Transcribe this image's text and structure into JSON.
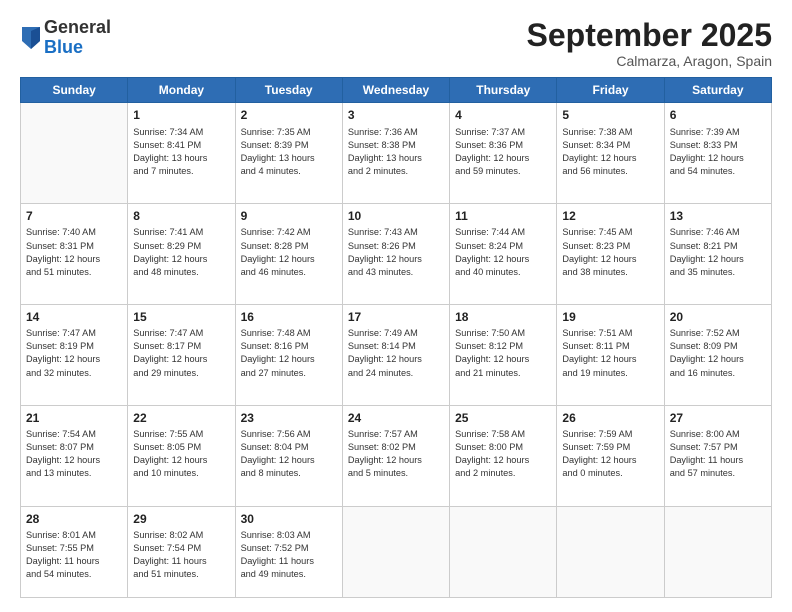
{
  "logo": {
    "line1": "General",
    "line2": "Blue"
  },
  "header": {
    "month": "September 2025",
    "location": "Calmarza, Aragon, Spain"
  },
  "weekdays": [
    "Sunday",
    "Monday",
    "Tuesday",
    "Wednesday",
    "Thursday",
    "Friday",
    "Saturday"
  ],
  "weeks": [
    [
      {
        "day": "",
        "lines": []
      },
      {
        "day": "1",
        "lines": [
          "Sunrise: 7:34 AM",
          "Sunset: 8:41 PM",
          "Daylight: 13 hours",
          "and 7 minutes."
        ]
      },
      {
        "day": "2",
        "lines": [
          "Sunrise: 7:35 AM",
          "Sunset: 8:39 PM",
          "Daylight: 13 hours",
          "and 4 minutes."
        ]
      },
      {
        "day": "3",
        "lines": [
          "Sunrise: 7:36 AM",
          "Sunset: 8:38 PM",
          "Daylight: 13 hours",
          "and 2 minutes."
        ]
      },
      {
        "day": "4",
        "lines": [
          "Sunrise: 7:37 AM",
          "Sunset: 8:36 PM",
          "Daylight: 12 hours",
          "and 59 minutes."
        ]
      },
      {
        "day": "5",
        "lines": [
          "Sunrise: 7:38 AM",
          "Sunset: 8:34 PM",
          "Daylight: 12 hours",
          "and 56 minutes."
        ]
      },
      {
        "day": "6",
        "lines": [
          "Sunrise: 7:39 AM",
          "Sunset: 8:33 PM",
          "Daylight: 12 hours",
          "and 54 minutes."
        ]
      }
    ],
    [
      {
        "day": "7",
        "lines": [
          "Sunrise: 7:40 AM",
          "Sunset: 8:31 PM",
          "Daylight: 12 hours",
          "and 51 minutes."
        ]
      },
      {
        "day": "8",
        "lines": [
          "Sunrise: 7:41 AM",
          "Sunset: 8:29 PM",
          "Daylight: 12 hours",
          "and 48 minutes."
        ]
      },
      {
        "day": "9",
        "lines": [
          "Sunrise: 7:42 AM",
          "Sunset: 8:28 PM",
          "Daylight: 12 hours",
          "and 46 minutes."
        ]
      },
      {
        "day": "10",
        "lines": [
          "Sunrise: 7:43 AM",
          "Sunset: 8:26 PM",
          "Daylight: 12 hours",
          "and 43 minutes."
        ]
      },
      {
        "day": "11",
        "lines": [
          "Sunrise: 7:44 AM",
          "Sunset: 8:24 PM",
          "Daylight: 12 hours",
          "and 40 minutes."
        ]
      },
      {
        "day": "12",
        "lines": [
          "Sunrise: 7:45 AM",
          "Sunset: 8:23 PM",
          "Daylight: 12 hours",
          "and 38 minutes."
        ]
      },
      {
        "day": "13",
        "lines": [
          "Sunrise: 7:46 AM",
          "Sunset: 8:21 PM",
          "Daylight: 12 hours",
          "and 35 minutes."
        ]
      }
    ],
    [
      {
        "day": "14",
        "lines": [
          "Sunrise: 7:47 AM",
          "Sunset: 8:19 PM",
          "Daylight: 12 hours",
          "and 32 minutes."
        ]
      },
      {
        "day": "15",
        "lines": [
          "Sunrise: 7:47 AM",
          "Sunset: 8:17 PM",
          "Daylight: 12 hours",
          "and 29 minutes."
        ]
      },
      {
        "day": "16",
        "lines": [
          "Sunrise: 7:48 AM",
          "Sunset: 8:16 PM",
          "Daylight: 12 hours",
          "and 27 minutes."
        ]
      },
      {
        "day": "17",
        "lines": [
          "Sunrise: 7:49 AM",
          "Sunset: 8:14 PM",
          "Daylight: 12 hours",
          "and 24 minutes."
        ]
      },
      {
        "day": "18",
        "lines": [
          "Sunrise: 7:50 AM",
          "Sunset: 8:12 PM",
          "Daylight: 12 hours",
          "and 21 minutes."
        ]
      },
      {
        "day": "19",
        "lines": [
          "Sunrise: 7:51 AM",
          "Sunset: 8:11 PM",
          "Daylight: 12 hours",
          "and 19 minutes."
        ]
      },
      {
        "day": "20",
        "lines": [
          "Sunrise: 7:52 AM",
          "Sunset: 8:09 PM",
          "Daylight: 12 hours",
          "and 16 minutes."
        ]
      }
    ],
    [
      {
        "day": "21",
        "lines": [
          "Sunrise: 7:54 AM",
          "Sunset: 8:07 PM",
          "Daylight: 12 hours",
          "and 13 minutes."
        ]
      },
      {
        "day": "22",
        "lines": [
          "Sunrise: 7:55 AM",
          "Sunset: 8:05 PM",
          "Daylight: 12 hours",
          "and 10 minutes."
        ]
      },
      {
        "day": "23",
        "lines": [
          "Sunrise: 7:56 AM",
          "Sunset: 8:04 PM",
          "Daylight: 12 hours",
          "and 8 minutes."
        ]
      },
      {
        "day": "24",
        "lines": [
          "Sunrise: 7:57 AM",
          "Sunset: 8:02 PM",
          "Daylight: 12 hours",
          "and 5 minutes."
        ]
      },
      {
        "day": "25",
        "lines": [
          "Sunrise: 7:58 AM",
          "Sunset: 8:00 PM",
          "Daylight: 12 hours",
          "and 2 minutes."
        ]
      },
      {
        "day": "26",
        "lines": [
          "Sunrise: 7:59 AM",
          "Sunset: 7:59 PM",
          "Daylight: 12 hours",
          "and 0 minutes."
        ]
      },
      {
        "day": "27",
        "lines": [
          "Sunrise: 8:00 AM",
          "Sunset: 7:57 PM",
          "Daylight: 11 hours",
          "and 57 minutes."
        ]
      }
    ],
    [
      {
        "day": "28",
        "lines": [
          "Sunrise: 8:01 AM",
          "Sunset: 7:55 PM",
          "Daylight: 11 hours",
          "and 54 minutes."
        ]
      },
      {
        "day": "29",
        "lines": [
          "Sunrise: 8:02 AM",
          "Sunset: 7:54 PM",
          "Daylight: 11 hours",
          "and 51 minutes."
        ]
      },
      {
        "day": "30",
        "lines": [
          "Sunrise: 8:03 AM",
          "Sunset: 7:52 PM",
          "Daylight: 11 hours",
          "and 49 minutes."
        ]
      },
      {
        "day": "",
        "lines": []
      },
      {
        "day": "",
        "lines": []
      },
      {
        "day": "",
        "lines": []
      },
      {
        "day": "",
        "lines": []
      }
    ]
  ]
}
